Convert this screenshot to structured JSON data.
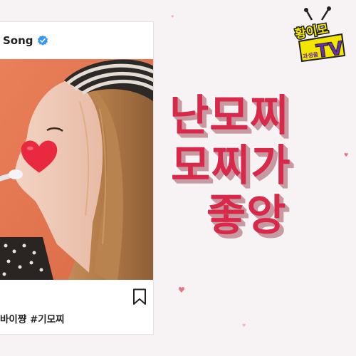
{
  "post": {
    "account_name": "Song",
    "caption": "바이쨩 #기모찌"
  },
  "channel_logo": {
    "line1": "황이모",
    "line2": "TV",
    "sub": "과생을"
  },
  "title": {
    "line1": "난모찌",
    "line2": "모찌가",
    "line3": "좋앙"
  },
  "colors": {
    "title_red": "#d9294b",
    "title_shadow": "#c79aa2",
    "photo_background": "#e0744f",
    "heart_sticker": "#e8293f",
    "logo_yellow": "#f3e600",
    "logo_purple": "#6a2fb0",
    "verified_blue": "#3897f0"
  },
  "icons": [
    "verified-badge-icon",
    "bookmark-icon",
    "heart-sticker-icon",
    "small-heart-icon"
  ]
}
